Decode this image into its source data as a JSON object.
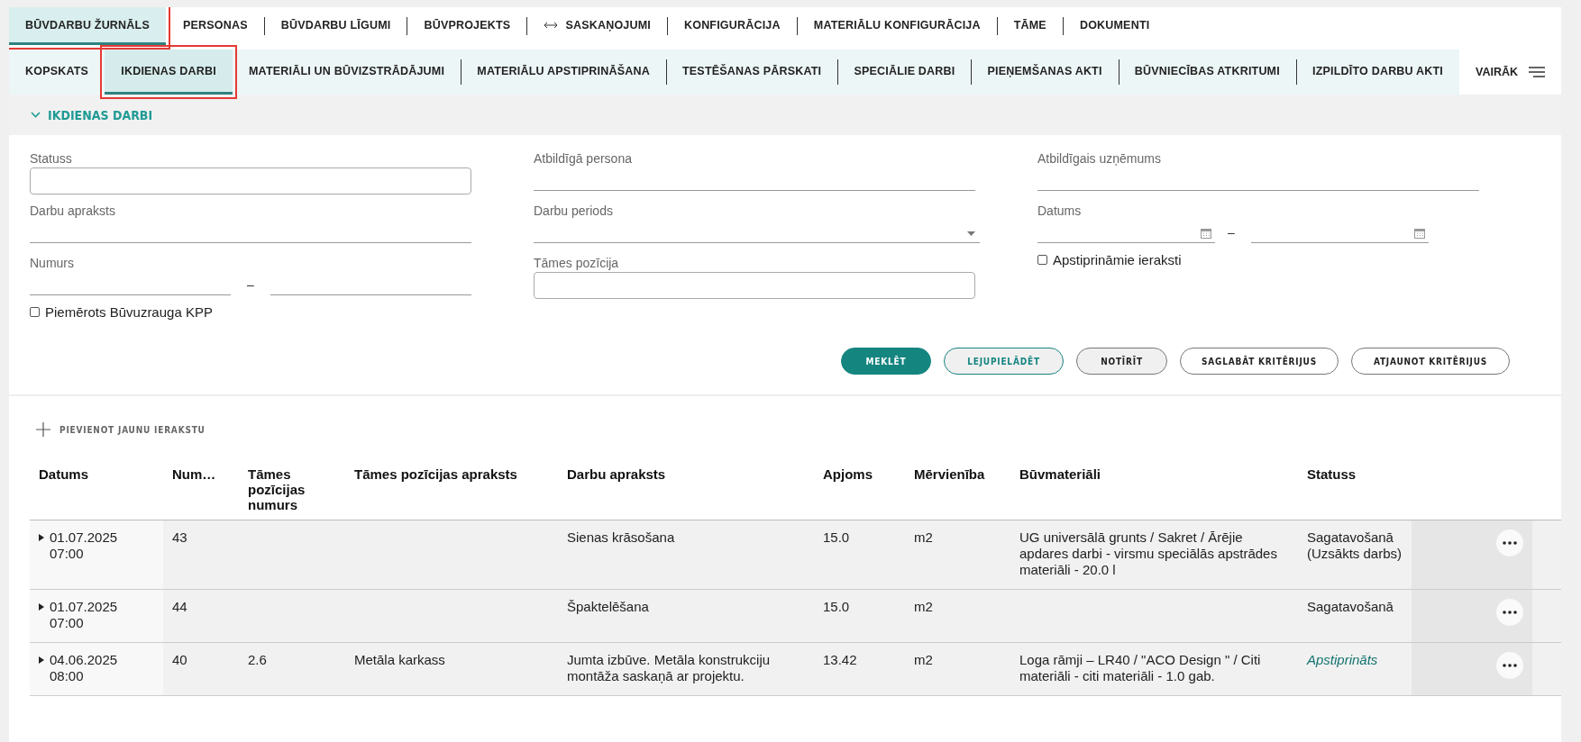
{
  "main_tabs": [
    {
      "label": "BŪVDARBU ŽURNĀLS",
      "selected": true,
      "highlighted": true
    },
    {
      "label": "PERSONAS",
      "selected": false,
      "highlighted": false
    },
    {
      "label": "BŪVDARBU LĪGUMI",
      "selected": false,
      "highlighted": false
    },
    {
      "label": "BŪVPROJEKTS",
      "selected": false,
      "highlighted": false
    },
    {
      "label": "SASKAŅOJUMI",
      "selected": false,
      "highlighted": false,
      "kind": "arrows"
    },
    {
      "label": "KONFIGURĀCIJA",
      "selected": false,
      "highlighted": false
    },
    {
      "label": "MATERIĀLU KONFIGURĀCIJA",
      "selected": false,
      "highlighted": false
    },
    {
      "label": "TĀME",
      "selected": false,
      "highlighted": false
    },
    {
      "label": "DOKUMENTI",
      "selected": false,
      "highlighted": false
    }
  ],
  "sub_tabs": [
    {
      "label": "KOPSKATS",
      "selected": false,
      "highlighted": false
    },
    {
      "label": "IKDIENAS DARBI",
      "selected": true,
      "highlighted": true
    },
    {
      "label": "MATERIĀLI UN BŪVIZSTRĀDĀJUMI",
      "selected": false,
      "highlighted": false
    },
    {
      "label": "MATERIĀLU APSTIPRINĀŠANA",
      "selected": false,
      "highlighted": false
    },
    {
      "label": "TESTĒŠANAS PĀRSKATI",
      "selected": false,
      "highlighted": false
    },
    {
      "label": "SPECIĀLIE DARBI",
      "selected": false,
      "highlighted": false
    },
    {
      "label": "PIEŅEMŠANAS AKTI",
      "selected": false,
      "highlighted": false
    },
    {
      "label": "BŪVNIECĪBAS ATKRITUMI",
      "selected": false,
      "highlighted": false
    },
    {
      "label": "IZPILDĪTO DARBU AKTI",
      "selected": false,
      "highlighted": false
    }
  ],
  "more_menu": "VAIRĀK",
  "section": {
    "title": "IKDIENAS DARBI",
    "expanded": true
  },
  "filters": [
    {
      "kind": "box",
      "label": "Statuss"
    },
    {
      "kind": "line",
      "label": "Atbildīgā persona"
    },
    {
      "kind": "line",
      "label": "Atbildīgais uzņēmums"
    },
    {
      "kind": "line",
      "label": "Darbu apraksts"
    },
    {
      "kind": "select",
      "label": "Darbu periods"
    },
    {
      "kind": "daterange",
      "label": "Datums",
      "separator": "–"
    },
    {
      "kind": "range",
      "label": "Numurs",
      "separator": "–"
    },
    {
      "kind": "box",
      "label": "Tāmes pozīcija"
    },
    {
      "kind": "checkbox",
      "label": "Apstiprināmie ieraksti",
      "checked": false
    },
    {
      "kind": "checkbox",
      "label": "Piemērots Būvuzrauga KPP",
      "checked": false
    }
  ],
  "actions": [
    {
      "label": "MEKLĒT",
      "kind": "primary"
    },
    {
      "label": "LEJUPIELĀDĒT",
      "kind": "outline"
    },
    {
      "label": "NOTĪRĪT",
      "kind": "grey"
    },
    {
      "label": "SAGLABĀT KRITĒRIJUS",
      "kind": "plain"
    },
    {
      "label": "ATJAUNOT KRITĒRIJUS",
      "kind": "plain"
    }
  ],
  "add_button": "PIEVIENOT JAUNU IERAKSTU",
  "table": {
    "columns": [
      "Datums",
      "Num…",
      "Tāmes pozīcijas numurs",
      "Tāmes pozīcijas apraksts",
      "Darbu apraksts",
      "Apjoms",
      "Mērvienība",
      "Būvmateriāli",
      "Statuss"
    ],
    "rows": [
      {
        "cells": [
          "01.07.2025 07:00",
          "43",
          "",
          "",
          "Sienas krāsošana",
          "15.0",
          "m2",
          "UG universālā grunts / Sakret / Ārējie apdares darbi - virsmu speciālās apstrādes materiāli - 20.0 l",
          "Sagatavošanā (Uzsākts darbs)"
        ],
        "approved": false
      },
      {
        "cells": [
          "01.07.2025 07:00",
          "44",
          "",
          "",
          "Špaktelēšana",
          "15.0",
          "m2",
          "",
          "Sagatavošanā"
        ],
        "approved": false
      },
      {
        "cells": [
          "04.06.2025 08:00",
          "40",
          "2.6",
          "Metāla karkass",
          "Jumta izbūve. Metāla konstrukciju montāža saskaņā ar projektu.",
          "13.42",
          "m2",
          "Loga rāmji – LR40 / \"ACO Design \" / Citi materiāli - citi materiāli - 1.0 gab.",
          "Apstiprināts"
        ],
        "approved": true
      }
    ]
  }
}
